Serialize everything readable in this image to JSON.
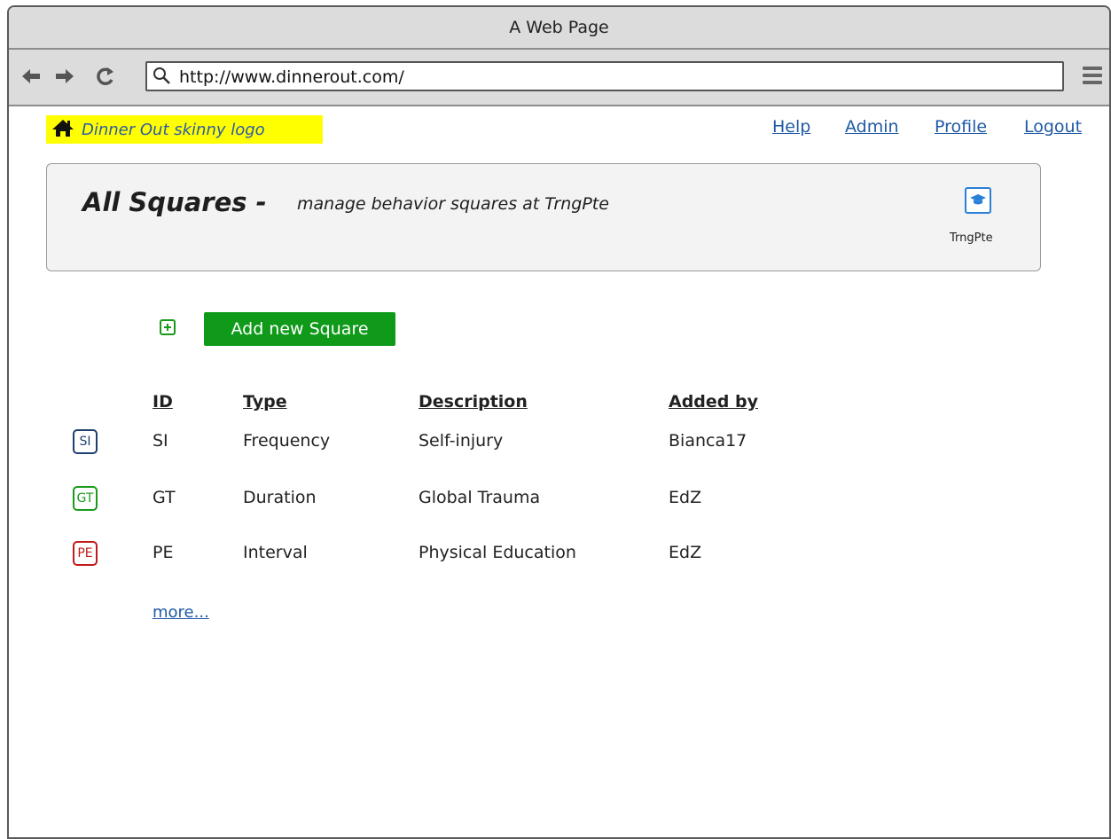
{
  "window": {
    "title": "A Web Page"
  },
  "browser": {
    "url": "http://www.dinnerout.com/"
  },
  "logo": {
    "text": "Dinner Out skinny logo"
  },
  "topnav": [
    {
      "label": "Help"
    },
    {
      "label": "Admin"
    },
    {
      "label": "Profile"
    },
    {
      "label": "Logout"
    }
  ],
  "header": {
    "title": "All Squares -",
    "subtitle": "manage behavior squares at TrngPte",
    "org_label": "TrngPte"
  },
  "actions": {
    "add_label": "Add new Square"
  },
  "table": {
    "columns": [
      "ID",
      "Type",
      "Description",
      "Added by"
    ],
    "rows": [
      {
        "badge": "SI",
        "badge_color": "#1f3f73",
        "id": "SI",
        "type": "Frequency",
        "description": "Self-injury",
        "added_by": "Bianca17"
      },
      {
        "badge": "GT",
        "badge_color": "#1a9a1a",
        "id": "GT",
        "type": "Duration",
        "description": "Global Trauma",
        "added_by": "EdZ"
      },
      {
        "badge": "PE",
        "badge_color": "#c21a1a",
        "id": "PE",
        "type": "Interval",
        "description": "Physical Education",
        "added_by": "EdZ"
      }
    ],
    "more_label": "more..."
  }
}
